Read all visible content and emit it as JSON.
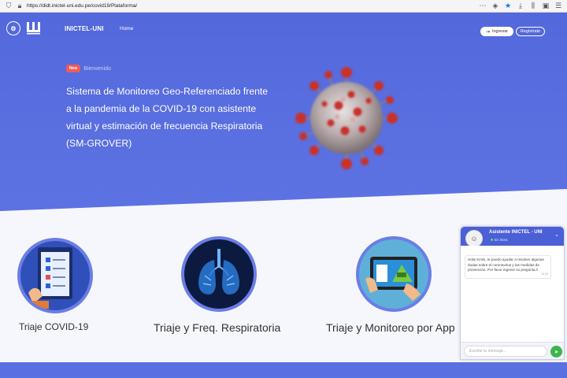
{
  "browser": {
    "url": "https://didt.inictel-uni.edu.pe/covid19/Plataforma/",
    "icons": [
      "shield-icon",
      "lock-icon",
      "more-icon",
      "star-icon",
      "download-icon",
      "library-icon",
      "sidebar-icon",
      "menu-icon"
    ]
  },
  "nav": {
    "brand": "INICTEL-UNI",
    "home": "Home",
    "login": "Ingresar",
    "register": "Regístrate"
  },
  "hero": {
    "badge": "New",
    "badge_text": "Bienvenido",
    "title": "Sistema de Monitoreo Geo-Referenciado frente a la pandemia de la COVID-19 con asistente virtual y estimación de frecuencia Respiratoria (SM-GROVER)",
    "colors": {
      "primary": "#5368dc",
      "badge": "#f05a5a"
    }
  },
  "cards": [
    {
      "title": "Triaje COVID-19",
      "icon": "clipboard-checklist-icon"
    },
    {
      "title": "Triaje y Freq. Respiratoria",
      "icon": "lungs-icon"
    },
    {
      "title": "Triaje y Monitoreo por App",
      "icon": "tablet-app-icon"
    }
  ],
  "chat": {
    "title": "Asistente INICTEL - UNI",
    "status": "En línea",
    "message": "Hola! Kriss, te puedo ayudar a resolver algunas dudas sobre el coronavirus y las medidas de prevención. Por favor ingrese su pregunta.!!",
    "time": "10:05",
    "placeholder": "Escribe tu mensaje...",
    "send_color": "#3bb54a"
  }
}
